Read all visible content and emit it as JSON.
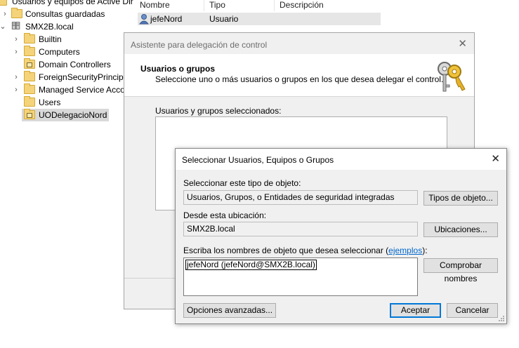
{
  "tree": {
    "root_label": "Usuarios y equipos de Active Directory",
    "saved_queries": "Consultas guardadas",
    "domain": "SMX2B.local",
    "children": [
      "Builtin",
      "Computers",
      "Domain Controllers",
      "ForeignSecurityPrincipals",
      "Managed Service Accounts",
      "Users",
      "UODelegacioNord"
    ]
  },
  "list": {
    "columns": [
      "Nombre",
      "Tipo",
      "Descripción"
    ],
    "rows": [
      {
        "name": "jefeNord",
        "type": "Usuario",
        "description": ""
      }
    ]
  },
  "wizard": {
    "title": "Asistente para delegación de control",
    "heading": "Usuarios o grupos",
    "subheading": "Seleccione uno o más usuarios o grupos en los que desea delegar el control.",
    "selected_label": "Usuarios y grupos seleccionados:"
  },
  "dialog": {
    "title": "Seleccionar Usuarios, Equipos o Grupos",
    "object_type_label": "Seleccionar este tipo de objeto:",
    "object_type_value": "Usuarios, Grupos, o Entidades de seguridad integradas",
    "object_types_button": "Tipos de objeto...",
    "location_label": "Desde esta ubicación:",
    "location_value": "SMX2B.local",
    "locations_button": "Ubicaciones...",
    "names_label_before": "Escriba los nombres de objeto que desea seleccionar (",
    "names_label_link": "ejemplos",
    "names_label_after": "):",
    "names_value": "jefeNord (jefeNord@SMX2B.local)",
    "check_names_button": "Comprobar nombres",
    "advanced_button": "Opciones avanzadas...",
    "ok_button": "Aceptar",
    "cancel_button": "Cancelar"
  },
  "colors": {
    "accent": "#0078d7",
    "link": "#0066cc",
    "folder": "#f4d37a"
  }
}
